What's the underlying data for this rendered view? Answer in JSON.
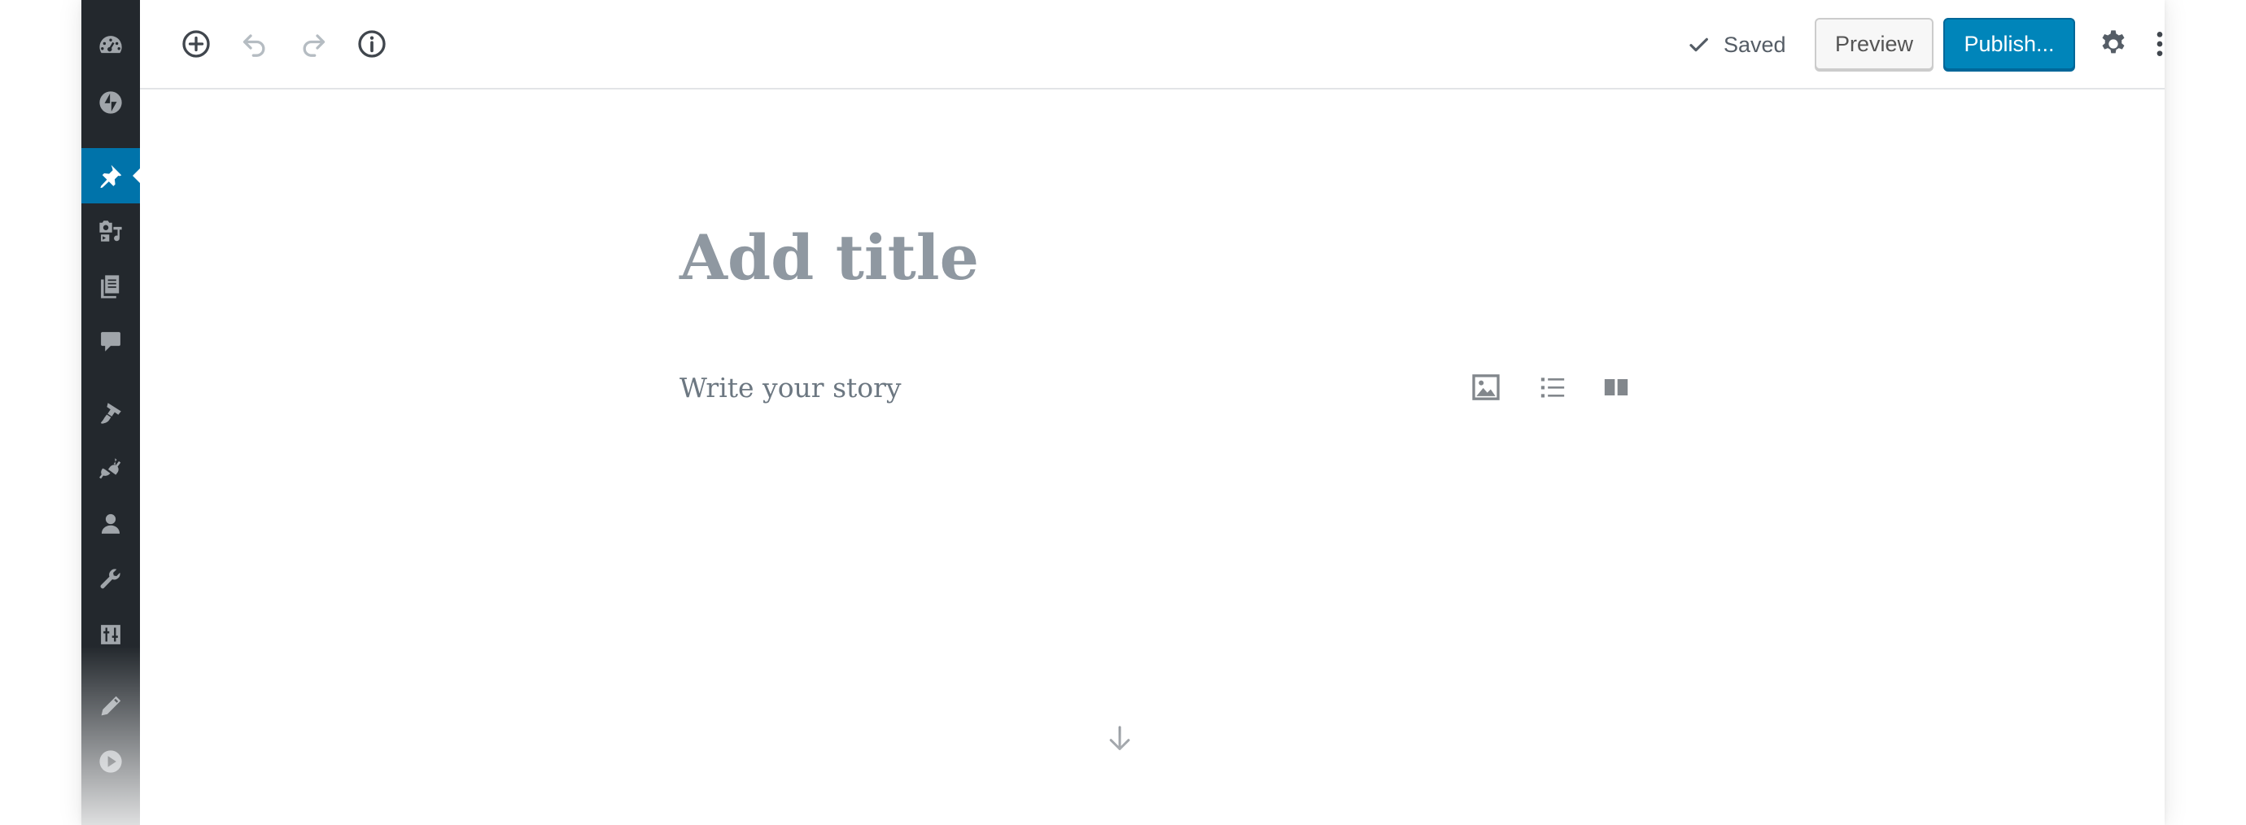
{
  "admin_menu": {
    "items": [
      {
        "name": "dashboard",
        "icon": "dashboard-icon"
      },
      {
        "name": "jetpack",
        "icon": "jetpack-bolt-icon"
      },
      {
        "name": "posts",
        "icon": "pin-icon",
        "active": true
      },
      {
        "name": "media",
        "icon": "media-icon"
      },
      {
        "name": "pages",
        "icon": "pages-icon"
      },
      {
        "name": "comments",
        "icon": "comment-icon"
      },
      {
        "name": "appearance",
        "icon": "paintbrush-icon"
      },
      {
        "name": "plugins",
        "icon": "plugin-icon"
      },
      {
        "name": "users",
        "icon": "user-icon"
      },
      {
        "name": "tools",
        "icon": "wrench-icon"
      },
      {
        "name": "settings",
        "icon": "settings-sliders-icon"
      },
      {
        "name": "edit",
        "icon": "pencil-icon"
      },
      {
        "name": "play",
        "icon": "play-icon"
      }
    ]
  },
  "header": {
    "tools": [
      {
        "name": "add-block",
        "icon": "plus-circle-icon"
      },
      {
        "name": "undo",
        "icon": "undo-icon"
      },
      {
        "name": "redo",
        "icon": "redo-icon"
      },
      {
        "name": "info",
        "icon": "info-icon"
      }
    ],
    "saved_label": "Saved",
    "preview_label": "Preview",
    "publish_label": "Publish...",
    "settings_icon": "gear-icon",
    "more_icon": "more-vertical-icon"
  },
  "editor": {
    "title_placeholder": "Add title",
    "body_placeholder": "Write your story",
    "inline_inserters": [
      {
        "name": "image",
        "icon": "image-icon"
      },
      {
        "name": "list",
        "icon": "list-icon"
      },
      {
        "name": "columns",
        "icon": "columns-icon"
      }
    ],
    "scroll_icon": "arrow-down-icon"
  },
  "colors": {
    "admin_bg": "#23282d",
    "admin_icon": "#a0a5aa",
    "active_item": "#0073aa",
    "publish_bg": "#0085ba",
    "placeholder_text": "#8f98a1"
  }
}
